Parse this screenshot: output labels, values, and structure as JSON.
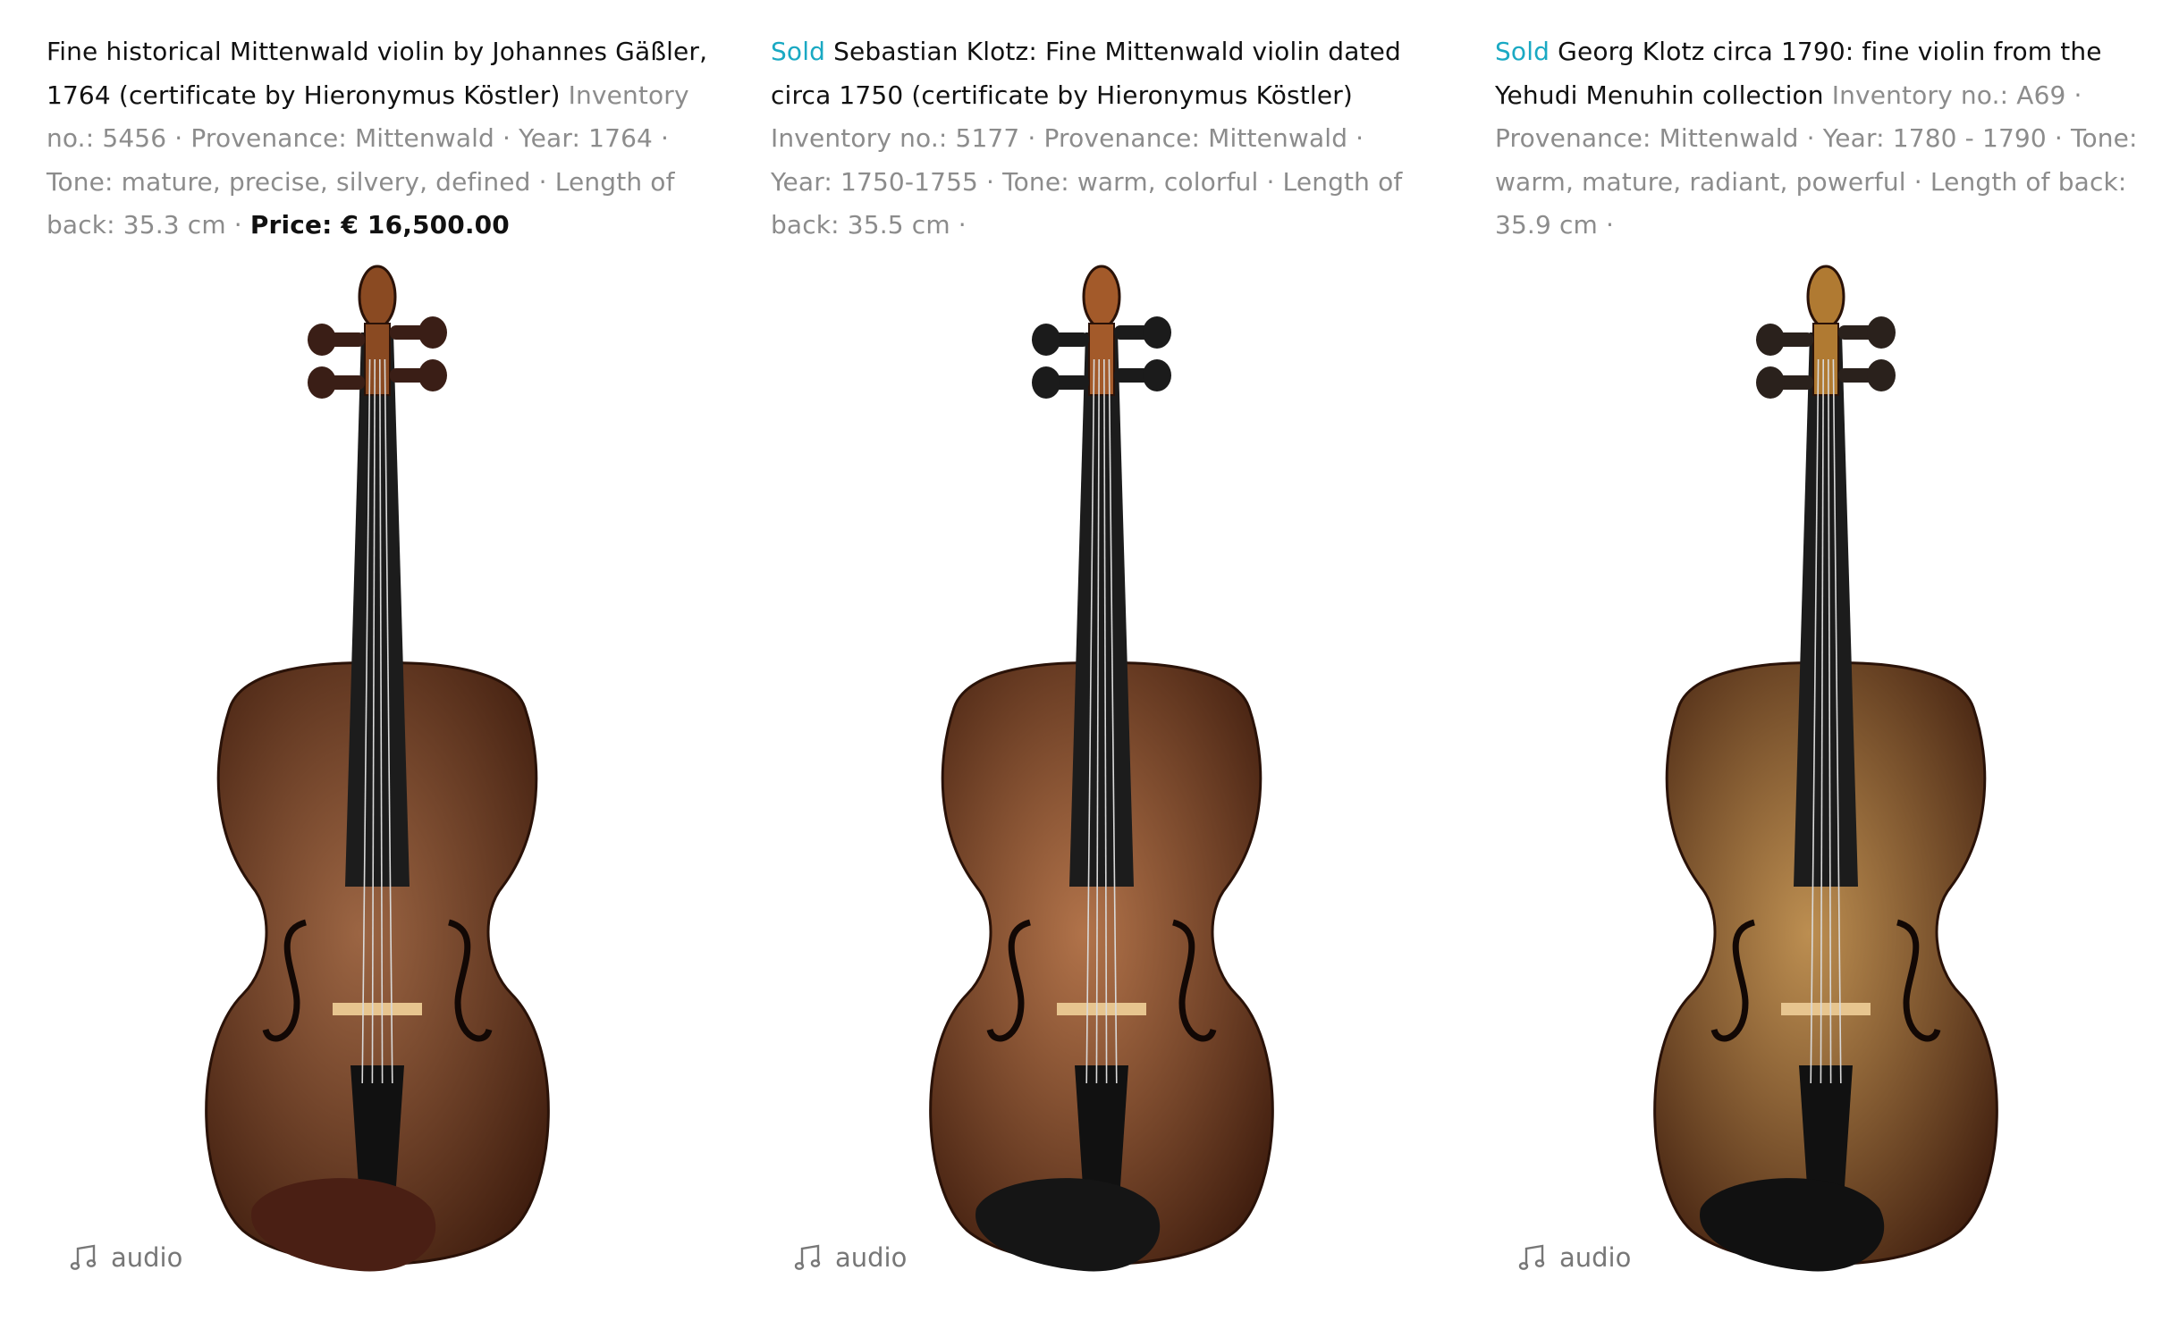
{
  "listings": [
    {
      "sold_label": "",
      "title": "Fine historical Mittenwald violin by Johannes Gäßler, 1764 (certificate by Hieronymus Köstler)",
      "meta": " Inventory no.: 5456 · Provenance: Mittenwald · Year: 1764 · Tone: mature, precise, silvery, defined · Length of back: 35.3 cm · ",
      "price": "Price: € 16,500.00",
      "audio_label": "audio",
      "audio_icon": "music-note-icon",
      "body_color": "#8a4a22",
      "chinrest_color": "#4a1f14",
      "peg_color": "#3a1e16"
    },
    {
      "sold_label": "Sold",
      "title": "Sebastian Klotz: Fine Mittenwald violin dated circa 1750 (certificate by Hieronymus Köstler)",
      "meta": " Inventory no.: 5177 · Provenance: Mittenwald · Year: 1750-1755 · Tone: warm, colorful · Length of back: 35.5 cm · ",
      "price": "",
      "audio_label": "audio",
      "audio_icon": "music-note-icon",
      "body_color": "#a35a2a",
      "chinrest_color": "#151515",
      "peg_color": "#1b1b1b"
    },
    {
      "sold_label": "Sold",
      "title": "Georg Klotz circa 1790: fine violin from the Yehudi Menuhin collection",
      "meta": " Inventory no.: A69 · Provenance: Mittenwald · Year: 1780 - 1790 · Tone: warm, mature, radiant, powerful · Length of back: 35.9 cm · ",
      "price": "",
      "audio_label": "audio",
      "audio_icon": "music-note-icon",
      "body_color": "#b07a32",
      "chinrest_color": "#111111",
      "peg_color": "#2a211c"
    }
  ]
}
